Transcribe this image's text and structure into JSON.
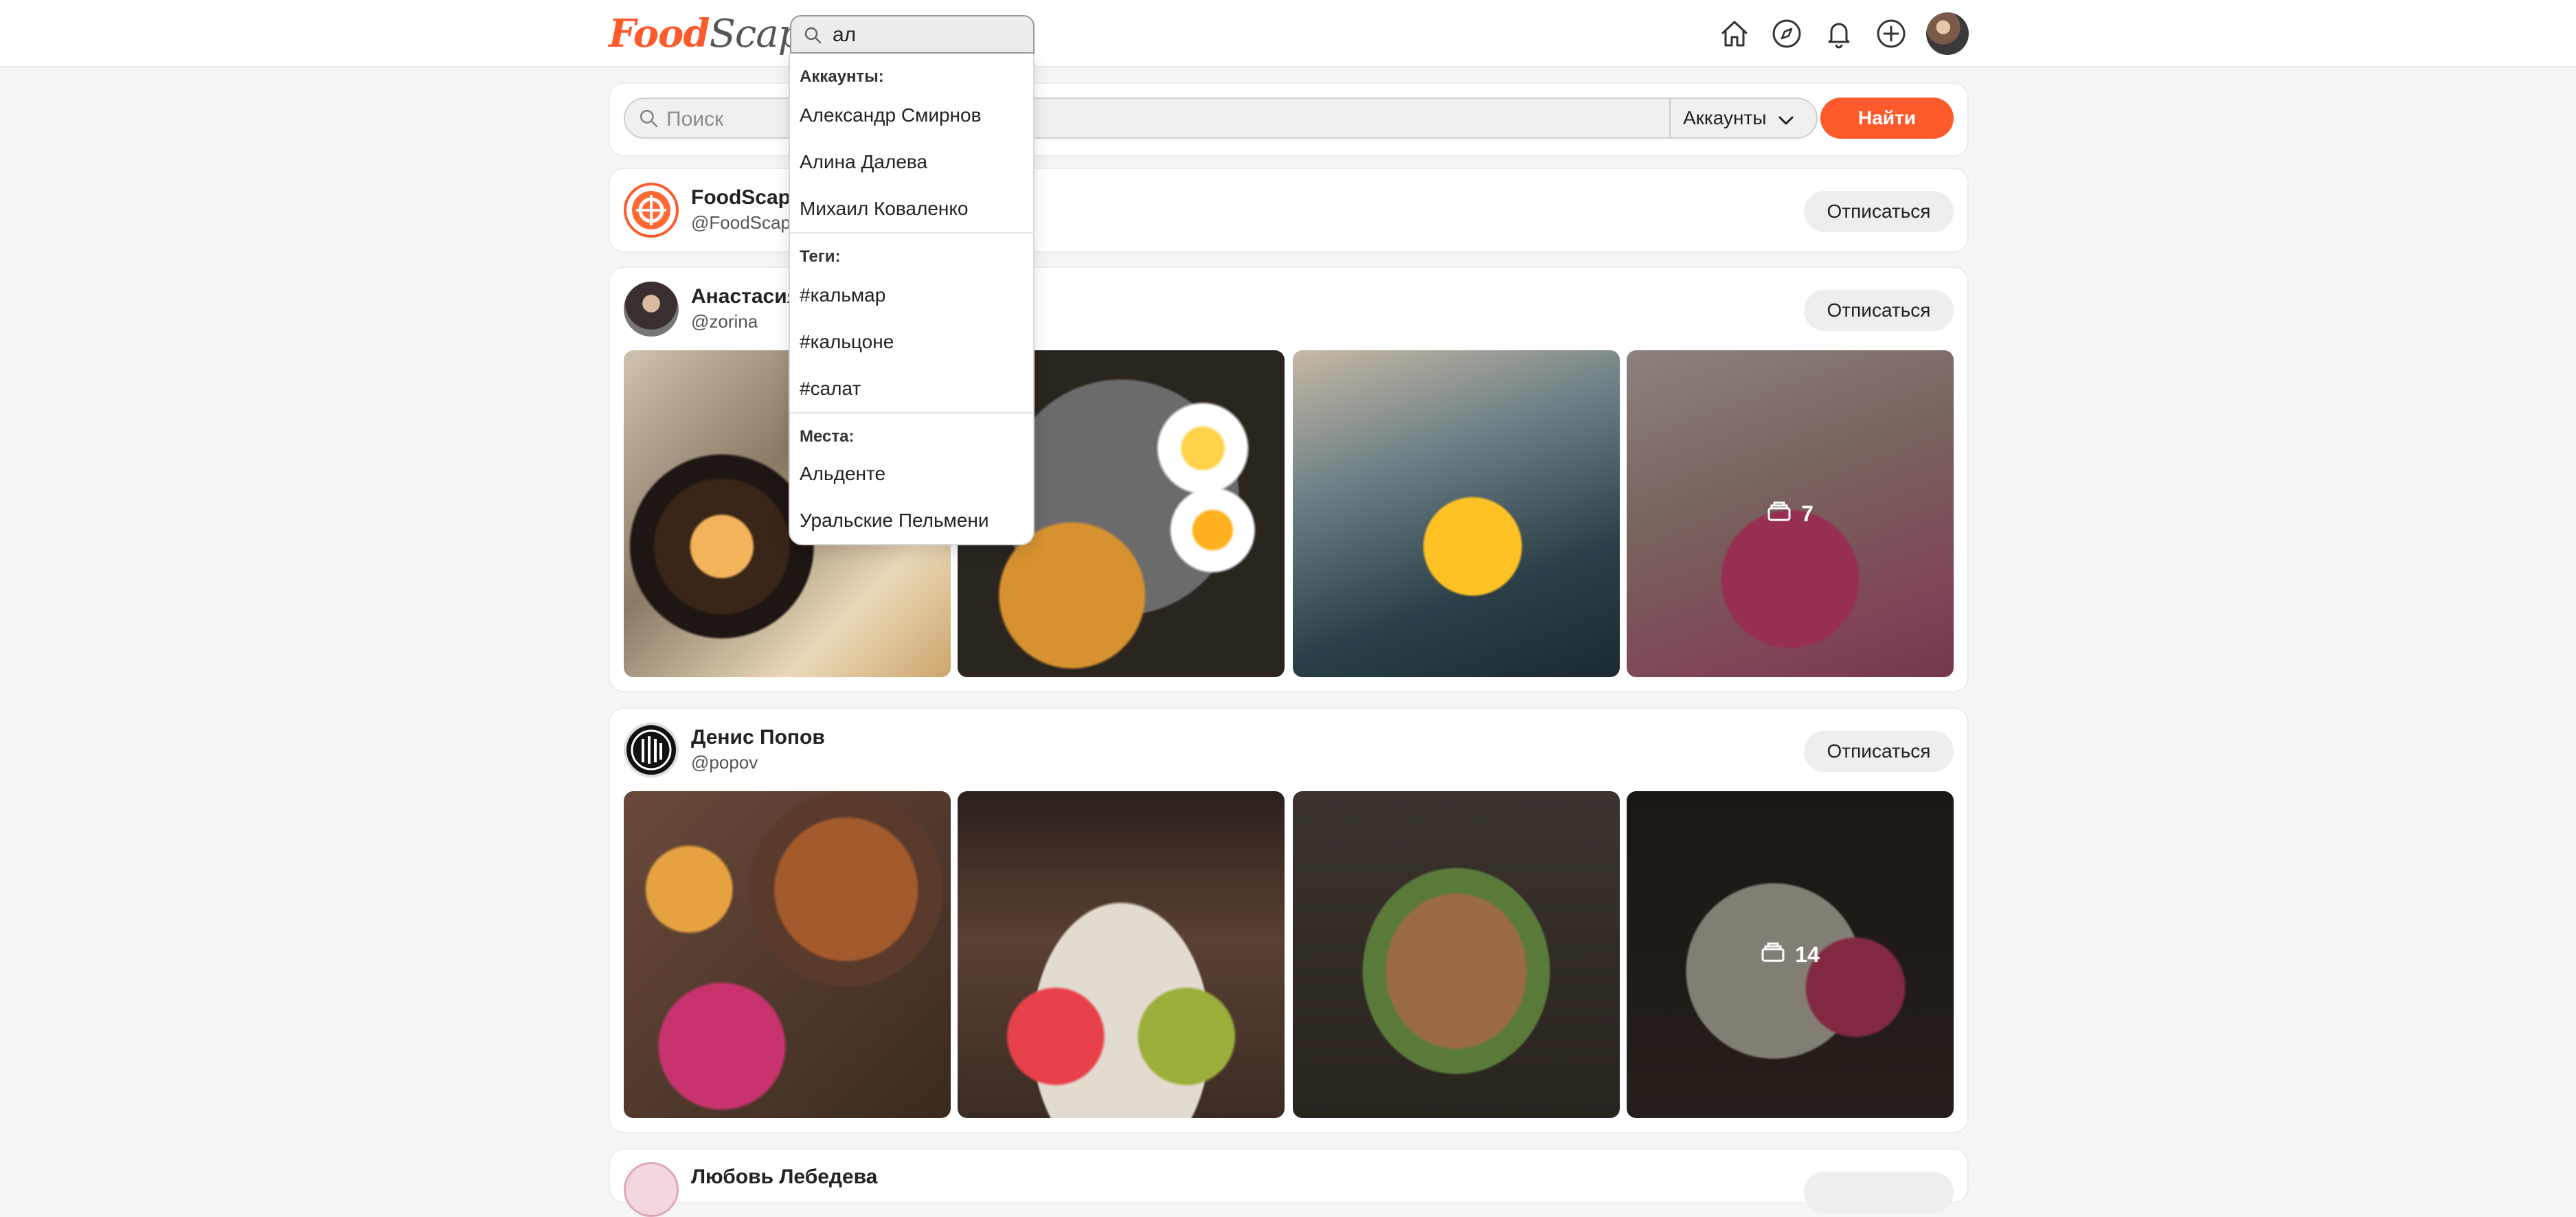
{
  "brand": {
    "part1": "Food",
    "part2": "Scape"
  },
  "top_search": {
    "value": "ал"
  },
  "nav": {
    "icons": [
      "home-icon",
      "compass-icon",
      "bell-icon",
      "plus-circle-icon"
    ]
  },
  "search_bar": {
    "placeholder": "Поиск",
    "filter_value": "Аккаунты",
    "button_label": "Найти"
  },
  "dropdown": {
    "accounts_title": "Аккаунты:",
    "accounts": [
      "Александр Смирнов",
      "Алина Далева",
      "Михаил Коваленко"
    ],
    "tags_title": "Теги:",
    "tags": [
      "#кальмар",
      "#кальцоне",
      "#салат"
    ],
    "places_title": "Места:",
    "places": [
      "Альденте",
      "Уральские Пельмени"
    ]
  },
  "feed": [
    {
      "name": "FoodScape",
      "handle": "@FoodScap",
      "button": "Отписаться"
    },
    {
      "name": "Анастасия",
      "handle": "@zorina",
      "button": "Отписаться",
      "more_count": "7"
    },
    {
      "name": "Денис Попов",
      "handle": "@popov",
      "button": "Отписаться",
      "more_count": "14"
    },
    {
      "name": "Любовь Лебедева"
    }
  ],
  "colors": {
    "accent": "#ff5a2c",
    "background": "#f5f5f7",
    "card": "#ffffff"
  }
}
